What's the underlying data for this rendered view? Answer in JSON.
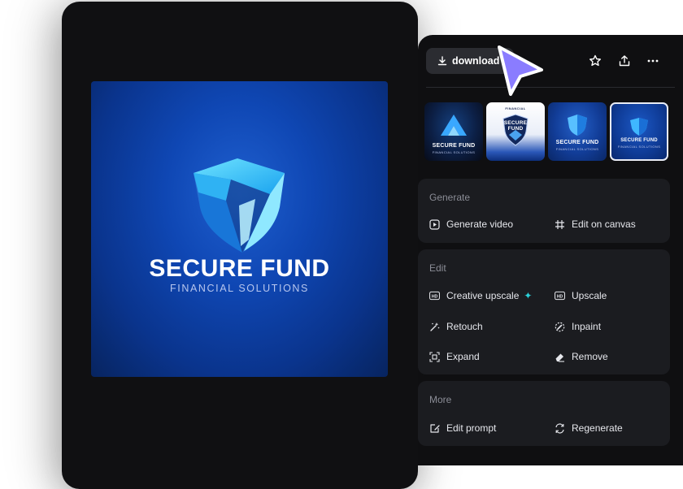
{
  "preview": {
    "brand_title": "SECURE FUND",
    "brand_subtitle": "FINANCIAL SOLUTIONS"
  },
  "toolbar": {
    "download_label": "download",
    "icons": [
      "download-icon",
      "star-icon",
      "share-icon",
      "more-icon"
    ]
  },
  "thumbnails": [
    {
      "title": "SECURE FUND",
      "subtitle": "FINANCIAL SOLUTIONS",
      "selected": false
    },
    {
      "title": "SECURE FUND",
      "subtitle": "FINANCIAL",
      "selected": false
    },
    {
      "title": "SECURE FUND",
      "subtitle": "FINANCIAL SOLUTIONS",
      "selected": false
    },
    {
      "title": "SECURE FUND",
      "subtitle": "FINANCIAL SOLUTIONS",
      "selected": true
    }
  ],
  "sections": {
    "generate": {
      "label": "Generate",
      "actions": [
        "Generate video",
        "Edit on canvas"
      ]
    },
    "edit": {
      "label": "Edit",
      "actions": [
        "Creative upscale",
        "Upscale",
        "Retouch",
        "Inpaint",
        "Expand",
        "Remove"
      ]
    },
    "more": {
      "label": "More",
      "actions": [
        "Edit prompt",
        "Regenerate"
      ]
    }
  },
  "colors": {
    "panel_bg": "#0f0f11",
    "section_bg": "#1b1c20",
    "accent_sparkle": "#2bd1d9",
    "cursor": "#8a7cff"
  }
}
